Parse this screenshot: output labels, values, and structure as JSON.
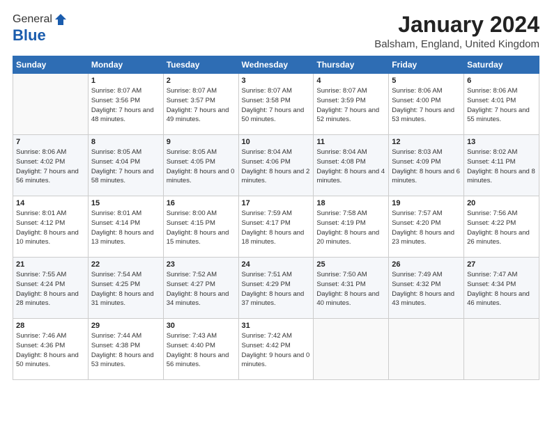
{
  "logo": {
    "general": "General",
    "blue": "Blue"
  },
  "title": "January 2024",
  "location": "Balsham, England, United Kingdom",
  "days_header": [
    "Sunday",
    "Monday",
    "Tuesday",
    "Wednesday",
    "Thursday",
    "Friday",
    "Saturday"
  ],
  "weeks": [
    [
      {
        "day": "",
        "sunrise": "",
        "sunset": "",
        "daylight": ""
      },
      {
        "day": "1",
        "sunrise": "Sunrise: 8:07 AM",
        "sunset": "Sunset: 3:56 PM",
        "daylight": "Daylight: 7 hours and 48 minutes."
      },
      {
        "day": "2",
        "sunrise": "Sunrise: 8:07 AM",
        "sunset": "Sunset: 3:57 PM",
        "daylight": "Daylight: 7 hours and 49 minutes."
      },
      {
        "day": "3",
        "sunrise": "Sunrise: 8:07 AM",
        "sunset": "Sunset: 3:58 PM",
        "daylight": "Daylight: 7 hours and 50 minutes."
      },
      {
        "day": "4",
        "sunrise": "Sunrise: 8:07 AM",
        "sunset": "Sunset: 3:59 PM",
        "daylight": "Daylight: 7 hours and 52 minutes."
      },
      {
        "day": "5",
        "sunrise": "Sunrise: 8:06 AM",
        "sunset": "Sunset: 4:00 PM",
        "daylight": "Daylight: 7 hours and 53 minutes."
      },
      {
        "day": "6",
        "sunrise": "Sunrise: 8:06 AM",
        "sunset": "Sunset: 4:01 PM",
        "daylight": "Daylight: 7 hours and 55 minutes."
      }
    ],
    [
      {
        "day": "7",
        "sunrise": "Sunrise: 8:06 AM",
        "sunset": "Sunset: 4:02 PM",
        "daylight": "Daylight: 7 hours and 56 minutes."
      },
      {
        "day": "8",
        "sunrise": "Sunrise: 8:05 AM",
        "sunset": "Sunset: 4:04 PM",
        "daylight": "Daylight: 7 hours and 58 minutes."
      },
      {
        "day": "9",
        "sunrise": "Sunrise: 8:05 AM",
        "sunset": "Sunset: 4:05 PM",
        "daylight": "Daylight: 8 hours and 0 minutes."
      },
      {
        "day": "10",
        "sunrise": "Sunrise: 8:04 AM",
        "sunset": "Sunset: 4:06 PM",
        "daylight": "Daylight: 8 hours and 2 minutes."
      },
      {
        "day": "11",
        "sunrise": "Sunrise: 8:04 AM",
        "sunset": "Sunset: 4:08 PM",
        "daylight": "Daylight: 8 hours and 4 minutes."
      },
      {
        "day": "12",
        "sunrise": "Sunrise: 8:03 AM",
        "sunset": "Sunset: 4:09 PM",
        "daylight": "Daylight: 8 hours and 6 minutes."
      },
      {
        "day": "13",
        "sunrise": "Sunrise: 8:02 AM",
        "sunset": "Sunset: 4:11 PM",
        "daylight": "Daylight: 8 hours and 8 minutes."
      }
    ],
    [
      {
        "day": "14",
        "sunrise": "Sunrise: 8:01 AM",
        "sunset": "Sunset: 4:12 PM",
        "daylight": "Daylight: 8 hours and 10 minutes."
      },
      {
        "day": "15",
        "sunrise": "Sunrise: 8:01 AM",
        "sunset": "Sunset: 4:14 PM",
        "daylight": "Daylight: 8 hours and 13 minutes."
      },
      {
        "day": "16",
        "sunrise": "Sunrise: 8:00 AM",
        "sunset": "Sunset: 4:15 PM",
        "daylight": "Daylight: 8 hours and 15 minutes."
      },
      {
        "day": "17",
        "sunrise": "Sunrise: 7:59 AM",
        "sunset": "Sunset: 4:17 PM",
        "daylight": "Daylight: 8 hours and 18 minutes."
      },
      {
        "day": "18",
        "sunrise": "Sunrise: 7:58 AM",
        "sunset": "Sunset: 4:19 PM",
        "daylight": "Daylight: 8 hours and 20 minutes."
      },
      {
        "day": "19",
        "sunrise": "Sunrise: 7:57 AM",
        "sunset": "Sunset: 4:20 PM",
        "daylight": "Daylight: 8 hours and 23 minutes."
      },
      {
        "day": "20",
        "sunrise": "Sunrise: 7:56 AM",
        "sunset": "Sunset: 4:22 PM",
        "daylight": "Daylight: 8 hours and 26 minutes."
      }
    ],
    [
      {
        "day": "21",
        "sunrise": "Sunrise: 7:55 AM",
        "sunset": "Sunset: 4:24 PM",
        "daylight": "Daylight: 8 hours and 28 minutes."
      },
      {
        "day": "22",
        "sunrise": "Sunrise: 7:54 AM",
        "sunset": "Sunset: 4:25 PM",
        "daylight": "Daylight: 8 hours and 31 minutes."
      },
      {
        "day": "23",
        "sunrise": "Sunrise: 7:52 AM",
        "sunset": "Sunset: 4:27 PM",
        "daylight": "Daylight: 8 hours and 34 minutes."
      },
      {
        "day": "24",
        "sunrise": "Sunrise: 7:51 AM",
        "sunset": "Sunset: 4:29 PM",
        "daylight": "Daylight: 8 hours and 37 minutes."
      },
      {
        "day": "25",
        "sunrise": "Sunrise: 7:50 AM",
        "sunset": "Sunset: 4:31 PM",
        "daylight": "Daylight: 8 hours and 40 minutes."
      },
      {
        "day": "26",
        "sunrise": "Sunrise: 7:49 AM",
        "sunset": "Sunset: 4:32 PM",
        "daylight": "Daylight: 8 hours and 43 minutes."
      },
      {
        "day": "27",
        "sunrise": "Sunrise: 7:47 AM",
        "sunset": "Sunset: 4:34 PM",
        "daylight": "Daylight: 8 hours and 46 minutes."
      }
    ],
    [
      {
        "day": "28",
        "sunrise": "Sunrise: 7:46 AM",
        "sunset": "Sunset: 4:36 PM",
        "daylight": "Daylight: 8 hours and 50 minutes."
      },
      {
        "day": "29",
        "sunrise": "Sunrise: 7:44 AM",
        "sunset": "Sunset: 4:38 PM",
        "daylight": "Daylight: 8 hours and 53 minutes."
      },
      {
        "day": "30",
        "sunrise": "Sunrise: 7:43 AM",
        "sunset": "Sunset: 4:40 PM",
        "daylight": "Daylight: 8 hours and 56 minutes."
      },
      {
        "day": "31",
        "sunrise": "Sunrise: 7:42 AM",
        "sunset": "Sunset: 4:42 PM",
        "daylight": "Daylight: 9 hours and 0 minutes."
      },
      {
        "day": "",
        "sunrise": "",
        "sunset": "",
        "daylight": ""
      },
      {
        "day": "",
        "sunrise": "",
        "sunset": "",
        "daylight": ""
      },
      {
        "day": "",
        "sunrise": "",
        "sunset": "",
        "daylight": ""
      }
    ]
  ]
}
